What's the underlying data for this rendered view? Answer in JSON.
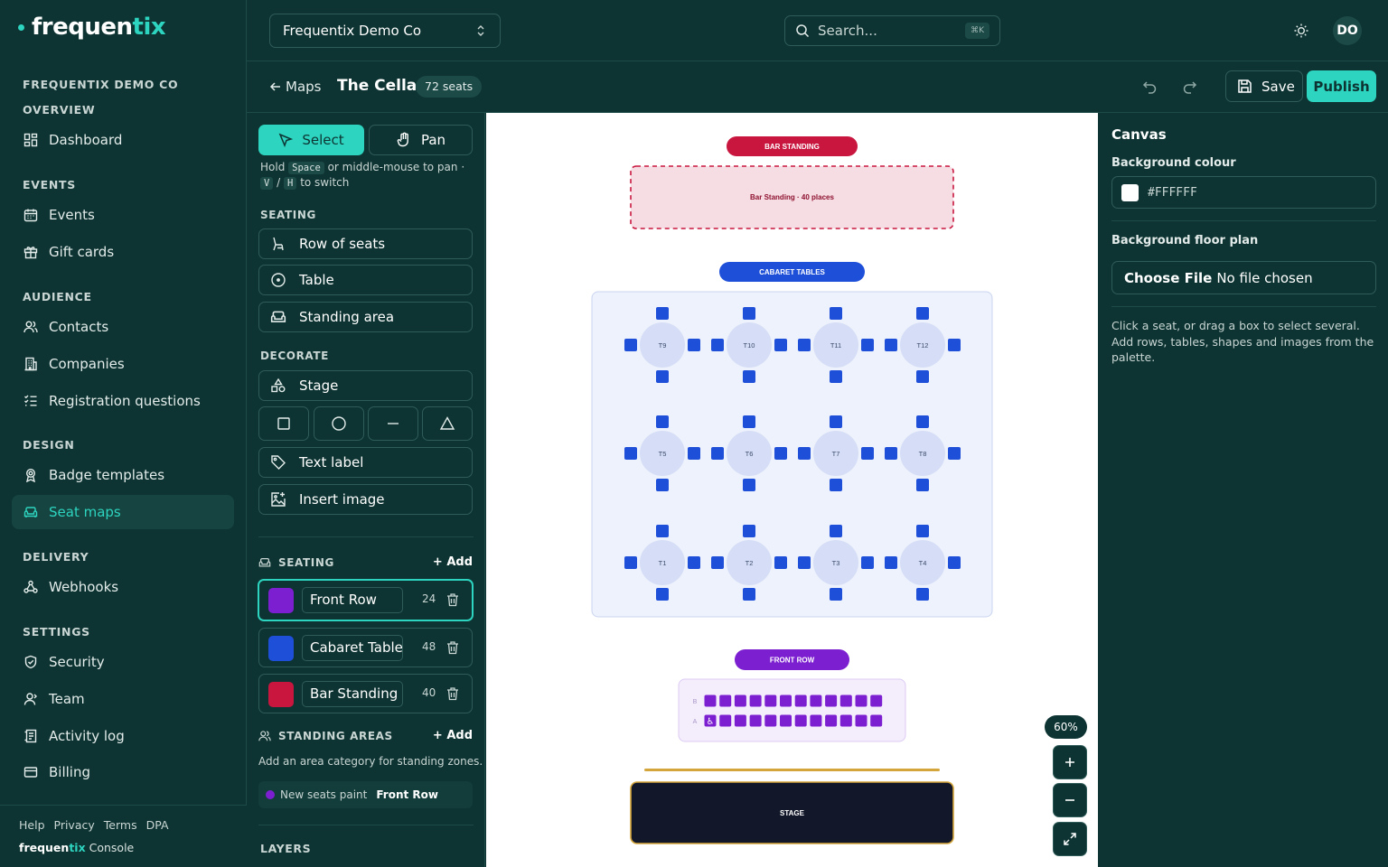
{
  "brand": {
    "prefix": "frequen",
    "suffix": "tix"
  },
  "sidebar": {
    "org_name": "FREQUENTIX DEMO CO",
    "sections": {
      "overview": "OVERVIEW",
      "events": "EVENTS",
      "audience": "AUDIENCE",
      "design": "DESIGN",
      "delivery": "DELIVERY",
      "settings": "SETTINGS"
    },
    "items": {
      "dashboard": "Dashboard",
      "events": "Events",
      "gift_cards": "Gift cards",
      "contacts": "Contacts",
      "companies": "Companies",
      "registration_questions": "Registration questions",
      "badge_templates": "Badge templates",
      "seat_maps": "Seat maps",
      "webhooks": "Webhooks",
      "security": "Security",
      "team": "Team",
      "activity_log": "Activity log",
      "billing": "Billing"
    },
    "footer": {
      "help": "Help",
      "privacy": "Privacy",
      "terms": "Terms",
      "dpa": "DPA",
      "brand_prefix": "frequen",
      "brand_suffix": "tix",
      "console": " Console"
    }
  },
  "topbar": {
    "org_select": "Frequentix Demo Co",
    "search_placeholder": "Search...",
    "search_shortcut": "⌘K",
    "avatar_initials": "DO"
  },
  "subbar": {
    "back_label": "Maps",
    "map_name": "The Cellar",
    "seat_count": "72 seats",
    "save_label": "Save",
    "publish_label": "Publish"
  },
  "palette": {
    "select_label": "Select",
    "pan_label": "Pan",
    "hint": {
      "hold": "Hold",
      "space": "Space",
      "or_middle": "or middle-mouse to pan ·",
      "v": "V",
      "slash": "/",
      "h": "H",
      "to_switch": "to switch"
    },
    "seating_head": "SEATING",
    "row_of_seats": "Row of seats",
    "table": "Table",
    "standing_area": "Standing area",
    "decorate_head": "DECORATE",
    "stage": "Stage",
    "text_label": "Text label",
    "insert_image": "Insert image",
    "seating_list_head": "SEATING",
    "add_label": "+ Add",
    "categories": [
      {
        "name": "Front Row",
        "count": "24",
        "color": "#7c1fd0"
      },
      {
        "name": "Cabaret Tables",
        "count": "48",
        "color": "#1e4fd8"
      },
      {
        "name": "Bar Standing",
        "count": "40",
        "color": "#c8163f"
      }
    ],
    "standing_head": "STANDING AREAS",
    "standing_add": "+ Add",
    "standing_hint": "Add an area category for standing zones.",
    "paint_label": "New seats paint",
    "paint_category": "Front Row",
    "layers_head": "LAYERS"
  },
  "canvas": {
    "bar_standing_tag": "BAR STANDING",
    "bar_standing_area": "Bar Standing · 40 places",
    "cabaret_tag": "CABARET TABLES",
    "front_row_tag": "FRONT ROW",
    "stage_label": "STAGE",
    "row_labels": [
      "B",
      "A"
    ],
    "tables_top": [
      "T9",
      "T10",
      "T11",
      "T12"
    ],
    "tables_mid": [
      "T5",
      "T6",
      "T7",
      "T8"
    ],
    "tables_bot": [
      "T1",
      "T2",
      "T3",
      "T4"
    ],
    "seats_per_row": 12,
    "zoom": "60%",
    "colors": {
      "bar": "#c8163f",
      "cabaret": "#1e4fd8",
      "front": "#7c1fd0",
      "stage": "#12172a",
      "stage_border": "#d4a53a"
    }
  },
  "inspector": {
    "title": "Canvas",
    "bg_colour_label": "Background colour",
    "bg_colour_value": "#FFFFFF",
    "floor_plan_label": "Background floor plan",
    "choose_file": "Choose File",
    "no_file": "No file chosen",
    "hint": "Click a seat, or drag a box to select several. Add rows, tables, shapes and images from the palette."
  }
}
